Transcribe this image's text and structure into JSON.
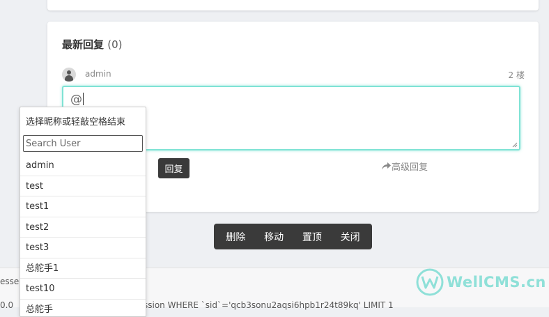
{
  "section": {
    "title": "最新回复",
    "count": "(0)"
  },
  "post": {
    "username": "admin",
    "floor": "2 楼"
  },
  "editor": {
    "value": "@"
  },
  "actions": {
    "reply_label": "回复",
    "advanced_label": "高级回复"
  },
  "toolbar": {
    "items": [
      "删除",
      "移动",
      "置顶",
      "关闭"
    ]
  },
  "footer": {
    "text1": "essed",
    "text2": "0.0",
    "text3": "ssion WHERE `sid`='qcb3sonu2aqsi6hpb1r24t89kq' LIMIT 1"
  },
  "logo": {
    "text": "WellCMS.cn",
    "color": "#8fe0d8"
  },
  "mention_dropdown": {
    "title": "选择昵称或轻敲空格结束",
    "search_placeholder": "Search User",
    "users": [
      "admin",
      "test",
      "test1",
      "test2",
      "test3",
      "总舵手1",
      "test10",
      "总舵手"
    ]
  },
  "colors": {
    "accent": "#7fe3d5",
    "button_bg": "#3a3a3a"
  }
}
